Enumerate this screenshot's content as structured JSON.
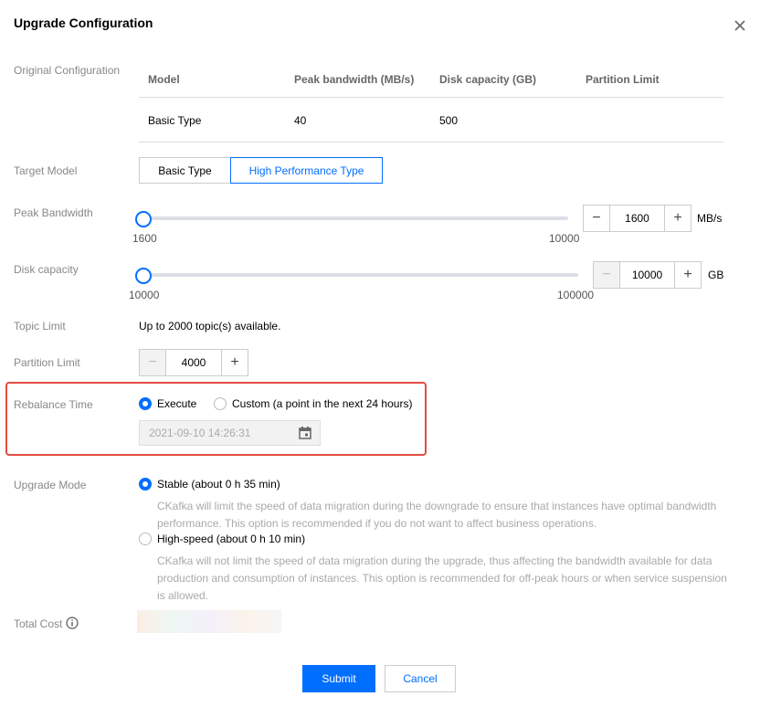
{
  "dialog": {
    "title": "Upgrade Configuration"
  },
  "labels": {
    "original": "Original Configuration",
    "target_model": "Target Model",
    "peak_bandwidth": "Peak Bandwidth",
    "disk_capacity": "Disk capacity",
    "topic_limit": "Topic Limit",
    "partition_limit": "Partition Limit",
    "rebalance_time": "Rebalance Time",
    "upgrade_mode": "Upgrade Mode",
    "total_cost": "Total Cost"
  },
  "original_table": {
    "headers": [
      "Model",
      "Peak bandwidth (MB/s)",
      "Disk capacity (GB)",
      "Partition Limit"
    ],
    "row": [
      "Basic Type",
      "40",
      "500",
      ""
    ]
  },
  "target_model": {
    "options": [
      "Basic Type",
      "High Performance Type"
    ],
    "selected": "High Performance Type"
  },
  "bandwidth": {
    "min": "1600",
    "max": "10000",
    "value": "1600",
    "unit": "MB/s",
    "slider_level": 0
  },
  "disk": {
    "min": "10000",
    "max": "100000",
    "value": "10000",
    "unit": "GB",
    "slider_level": 0
  },
  "topic_limit": {
    "text": "Up to 2000 topic(s) available."
  },
  "partition": {
    "value": "4000"
  },
  "rebalance": {
    "execute_label": "Execute",
    "custom_label": "Custom (a point in the next 24 hours)",
    "selected": "Execute",
    "datetime_value": "2021-09-10 14:26:31"
  },
  "upgrade_mode": {
    "stable_label": "Stable (about 0 h 35 min)",
    "stable_desc": "CKafka will limit the speed of data migration during the downgrade to ensure that instances have optimal bandwidth performance. This option is recommended if you do not want to affect business operations.",
    "highspeed_label": "High-speed (about 0 h 10 min)",
    "highspeed_desc": "CKafka will not limit the speed of data migration during the upgrade, thus affecting the bandwidth available for data production and consumption of instances. This option is recommended for off-peak hours or when service suspension is allowed.",
    "selected": "Stable"
  },
  "buttons": {
    "submit": "Submit",
    "cancel": "Cancel"
  },
  "icons": {
    "close": "close-icon",
    "info": "info-icon",
    "calendar": "calendar-icon",
    "minus": "minus-icon",
    "plus": "plus-icon"
  },
  "colors": {
    "primary": "#006eff",
    "highlight": "#e34d42"
  }
}
